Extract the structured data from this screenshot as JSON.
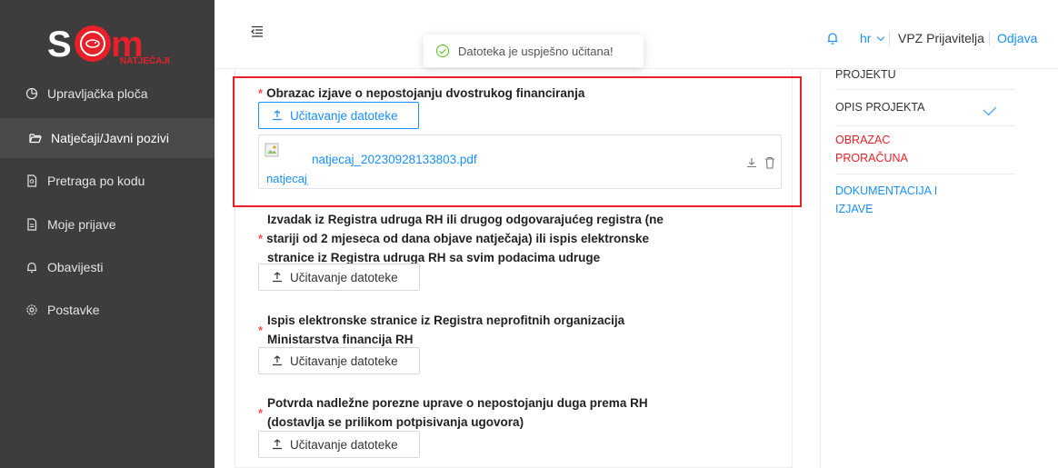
{
  "app": {
    "logo_text": "SOM",
    "logo_subtitle": "NATJEČAJI"
  },
  "sidebar": {
    "items": [
      {
        "label": "Upravljačka ploča",
        "icon": "dashboard-icon"
      },
      {
        "label": "Natječaji/Javni pozivi",
        "icon": "folder-open-icon",
        "active": true
      },
      {
        "label": "Pretraga po kodu",
        "icon": "file-search-icon"
      },
      {
        "label": "Moje prijave",
        "icon": "file-text-icon"
      },
      {
        "label": "Obavijesti",
        "icon": "bell-icon"
      },
      {
        "label": "Postavke",
        "icon": "gear-icon"
      }
    ]
  },
  "header": {
    "language": "hr",
    "user_name": "VPZ Prijavitelja",
    "logout_label": "Odjava"
  },
  "toast": {
    "message": "Datoteka je uspješno učitana!"
  },
  "documents": [
    {
      "label": "Obrazac izjave o nepostojanju dvostrukog financiranja",
      "required": true,
      "upload_label": "Učitavanje datoteke",
      "uploaded_file": {
        "name": "natjecaj_20230928133803.pdf",
        "thumb_alt": "natjecaj_20230928133803.pdf"
      }
    },
    {
      "label_lines": [
        "Izvadak iz Registra udruga RH ili drugog odgovarajućeg registra (ne",
        "stariji od 2 mjeseca od dana objave natječaja) ili ispis elektronske",
        "stranice iz Registra udruga RH sa svim podacima udruge"
      ],
      "required": true,
      "upload_label": "Učitavanje datoteke"
    },
    {
      "label_lines": [
        "Ispis elektronske stranice iz Registra neprofitnih organizacija",
        "Ministarstva financija RH"
      ],
      "required": true,
      "upload_label": "Učitavanje datoteke"
    },
    {
      "label_lines": [
        "Potvrda nadležne porezne uprave o nepostojanju duga prema RH",
        "(dostavlja se prilikom potpisivanja ugovora)"
      ],
      "required": true,
      "upload_label": "Učitavanje datoteke"
    }
  ],
  "steps": [
    {
      "label": "PROJEKTU",
      "color": "#333333"
    },
    {
      "label": "OPIS PROJEKTA",
      "color": "#333333",
      "done": true
    },
    {
      "label_lines": [
        "OBRAZAC",
        "PRORAČUNA"
      ],
      "color": "#e8202a"
    },
    {
      "label_lines": [
        "DOKUMENTACIJA I",
        "IZJAVE"
      ],
      "color": "#1890ff"
    }
  ],
  "colors": {
    "sidebar_bg": "#3d3d3d",
    "accent": "#1890ff",
    "required": "#ff4d4f",
    "highlight": "#e8202a",
    "success": "#52c41a"
  }
}
